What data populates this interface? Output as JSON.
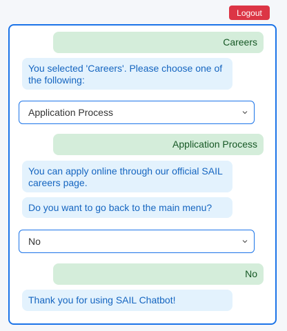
{
  "header": {
    "logout_label": "Logout"
  },
  "chat": {
    "msg1_user": "Careers",
    "msg2_bot": "You selected 'Careers'. Please choose one of the following:",
    "select1_value": "Application Process",
    "msg3_user": "Application Process",
    "msg4_bot": "You can apply online through our official SAIL careers page.",
    "msg5_bot": "Do you want to go back to the main menu?",
    "select2_value": "No",
    "msg6_user": "No",
    "msg7_bot": "Thank you for using SAIL Chatbot!"
  },
  "icons": {
    "dropdown": "chevron-down-icon"
  },
  "colors": {
    "accent": "#1a73e8",
    "logout": "#dc3545",
    "user_bubble": "#d4edda",
    "bot_bubble": "#e3f2fd"
  }
}
